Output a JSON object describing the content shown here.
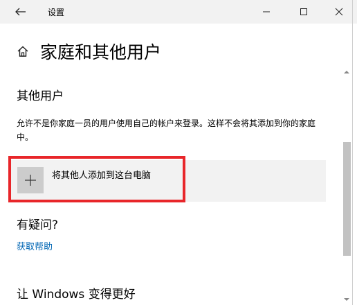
{
  "titlebar": {
    "title": "设置",
    "back_icon": "back-arrow-icon",
    "minimize_icon": "minimize-icon",
    "maximize_icon": "maximize-icon",
    "close_icon": "close-icon"
  },
  "header": {
    "home_icon": "home-icon",
    "page_title": "家庭和其他用户"
  },
  "other_users": {
    "title": "其他用户",
    "description": "允许不是你家庭一员的用户使用自己的帐户来登录。这样不会将其添加到你的家庭中。",
    "add_button_label": "将其他人添加到这台电脑",
    "add_icon": "plus-icon"
  },
  "help": {
    "title": "有疑问?",
    "link_label": "获取帮助"
  },
  "improve": {
    "title": "让 Windows 变得更好"
  },
  "colors": {
    "link": "#0066b4",
    "highlight": "#e8262a",
    "tile_bg": "#cccccc",
    "row_bg": "#f2f2f2",
    "titlebar_bg": "#f2f2f2"
  }
}
